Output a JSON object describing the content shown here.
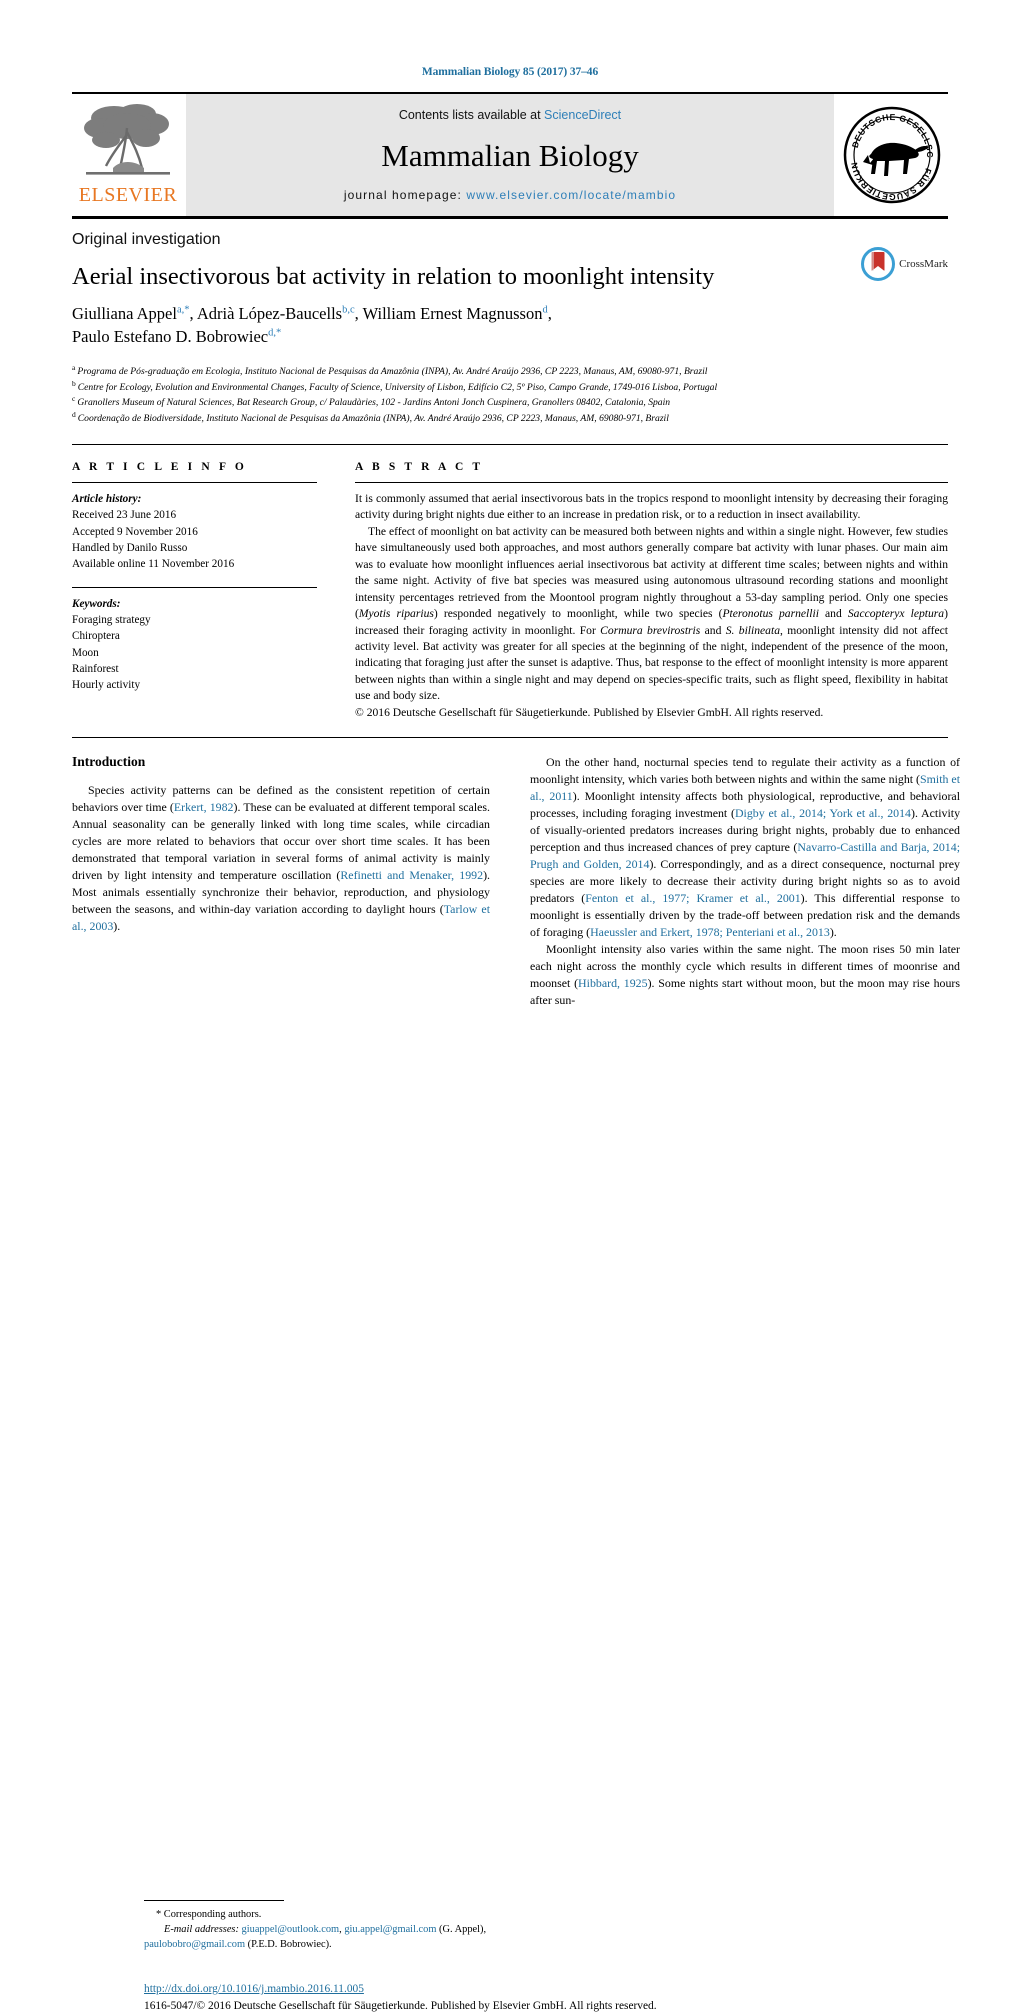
{
  "running_head": "Mammalian Biology 85 (2017) 37–46",
  "masthead": {
    "contents_prefix": "Contents lists available at ",
    "contents_link": "ScienceDirect",
    "journal_name": "Mammalian Biology",
    "homepage_prefix": "journal homepage: ",
    "homepage_url": "www.elsevier.com/locate/mambio",
    "publisher_wordmark": "ELSEVIER",
    "society_logo_alt": "Deutsche Gesellschaft für Säugetierkunde"
  },
  "article": {
    "type": "Original investigation",
    "title": "Aerial insectivorous bat activity in relation to moonlight intensity",
    "authors_line1": "Giulliana Appel",
    "authors_line1_sup": "a,*",
    "authors_sep1": ", Adrià López-Baucells",
    "authors_sup2": "b,c",
    "authors_sep2": ", William Ernest Magnusson",
    "authors_sup3": "d",
    "authors_line2": "Paulo Estefano D. Bobrowiec",
    "authors_line2_sup": "d,*",
    "crossmark_label": "CrossMark"
  },
  "affiliations": [
    {
      "marker": "a",
      "text": "Programa de Pós-graduação em Ecologia, Instituto Nacional de Pesquisas da Amazônia (INPA), Av. André Araújo 2936, CP 2223, Manaus, AM, 69080-971, Brazil"
    },
    {
      "marker": "b",
      "text": "Centre for Ecology, Evolution and Environmental Changes, Faculty of Science, University of Lisbon, Edifício C2, 5º Piso, Campo Grande, 1749-016 Lisboa, Portugal"
    },
    {
      "marker": "c",
      "text": "Granollers Museum of Natural Sciences, Bat Research Group, c/ Palaudàries, 102 - Jardins Antoni Jonch Cuspinera, Granollers 08402, Catalonia, Spain"
    },
    {
      "marker": "d",
      "text": "Coordenação de Biodiversidade, Instituto Nacional de Pesquisas da Amazônia (INPA), Av. André Araújo 2936, CP 2223, Manaus, AM, 69080-971, Brazil"
    }
  ],
  "article_info": {
    "label": "A R T I C L E    I N F O",
    "history_label": "Article history:",
    "history": [
      "Received 23 June 2016",
      "Accepted 9 November 2016",
      "Handled by Danilo Russo",
      "Available online 11 November 2016"
    ],
    "keywords_label": "Keywords:",
    "keywords": [
      "Foraging strategy",
      "Chiroptera",
      "Moon",
      "Rainforest",
      "Hourly activity"
    ]
  },
  "abstract": {
    "label": "A B S T R A C T",
    "para1": "It is commonly assumed that aerial insectivorous bats in the tropics respond to moonlight intensity by decreasing their foraging activity during bright nights due either to an increase in predation risk, or to a reduction in insect availability.",
    "para2_a": "The effect of moonlight on bat activity can be measured both between nights and within a single night. However, few studies have simultaneously used both approaches, and most authors generally compare bat activity with lunar phases. Our main aim was to evaluate how moonlight influences aerial insectivorous bat activity at different time scales; between nights and within the same night. Activity of five bat species was measured using autonomous ultrasound recording stations and moonlight intensity percentages retrieved from the Moontool program nightly throughout a 53-day sampling period. Only one species (",
    "sp1": "Myotis riparius",
    "para2_b": ") responded negatively to moonlight, while two species (",
    "sp2": "Pteronotus parnellii",
    "para2_c": " and ",
    "sp3": "Saccopteryx leptura",
    "para2_d": ") increased their foraging activity in moonlight. For ",
    "sp4": "Cormura brevirostris",
    "para2_e": " and ",
    "sp5": "S. bilineata",
    "para2_f": ", moonlight intensity did not affect activity level. Bat activity was greater for all species at the beginning of the night, independent of the presence of the moon, indicating that foraging just after the sunset is adaptive. Thus, bat response to the effect of moonlight intensity is more apparent between nights than within a single night and may depend on species-specific traits, such as flight speed, flexibility in habitat use and body size.",
    "copyright": "© 2016 Deutsche Gesellschaft für Säugetierkunde. Published by Elsevier GmbH. All rights reserved."
  },
  "introduction": {
    "heading": "Introduction",
    "left": {
      "p1_a": "Species activity patterns can be defined as the consistent repetition of certain behaviors over time (",
      "c1": "Erkert, 1982",
      "p1_b": "). These can be evaluated at different temporal scales. Annual seasonality can be generally linked with long time scales, while circadian cycles are more related to behaviors that occur over short time scales. It has been demonstrated that temporal variation in several forms of animal activity is mainly driven by light intensity and temperature oscillation (",
      "c2": "Refinetti and Menaker, 1992",
      "p1_c": "). Most animals essentially synchronize their behavior, reproduction, and physiology between the seasons, and within-day variation according to daylight hours (",
      "c3": "Tarlow et al., 2003",
      "p1_d": ")."
    },
    "right": {
      "p1_a": "On the other hand, nocturnal species tend to regulate their activity as a function of moonlight intensity, which varies both between nights and within the same night (",
      "c1": "Smith et al., 2011",
      "p1_b": "). Moonlight intensity affects both physiological, reproductive, and behavioral processes, including foraging investment (",
      "c2": "Digby et al., 2014; York et al., 2014",
      "p1_c": "). Activity of visually-oriented predators increases during bright nights, probably due to enhanced perception and thus increased chances of prey capture (",
      "c3": "Navarro-Castilla and Barja, 2014; Prugh and Golden, 2014",
      "p1_d": "). Correspondingly, and as a direct consequence, nocturnal prey species are more likely to decrease their activity during bright nights so as to avoid predators (",
      "c4": "Fenton et al., 1977; Kramer et al., 2001",
      "p1_e": "). This differential response to moonlight is essentially driven by the trade-off between predation risk and the demands of foraging (",
      "c5": "Haeussler and Erkert, 1978; Penteriani et al., 2013",
      "p1_f": ").",
      "p2_a": "Moonlight intensity also varies within the same night. The moon rises 50 min later each night across the monthly cycle which results in different times of moonrise and moonset (",
      "c6": "Hibbard, 1925",
      "p2_b": "). Some nights start without moon, but the moon may rise hours after sun-"
    }
  },
  "footnotes": {
    "corresponding": "* Corresponding authors.",
    "email_label": "E-mail addresses:",
    "email1": "giuappel@outlook.com",
    "email2": "giu.appel@gmail.com",
    "email1_owner": " (G. Appel),",
    "email3": "paulobobro@gmail.com",
    "email3_owner": " (P.E.D. Bobrowiec)."
  },
  "doi_block": {
    "doi": "http://dx.doi.org/10.1016/j.mambio.2016.11.005",
    "issn_line": "1616-5047/© 2016 Deutsche Gesellschaft für Säugetierkunde. Published by Elsevier GmbH. All rights reserved."
  },
  "colors": {
    "link_blue": "#1f6f9e",
    "sciencedirect_blue": "#2e7fb8",
    "elsevier_orange": "#E87722",
    "banner_gray": "#e6e6e6"
  }
}
